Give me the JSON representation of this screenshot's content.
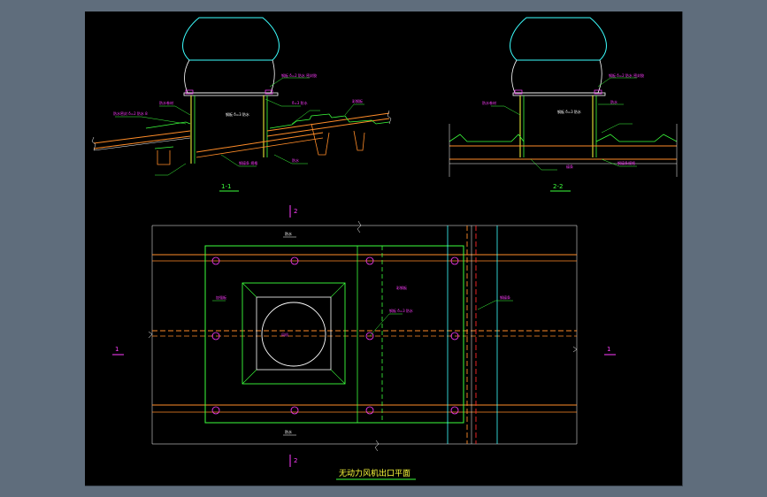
{
  "colors": {
    "background": "#000000",
    "frame": "#5f6d7c",
    "white": "#ffffff",
    "green": "#3cff3c",
    "cyan": "#3cffff",
    "magenta": "#ff3cff",
    "yellow": "#ffff3c",
    "orange": "#ff8c28",
    "red": "#ff2a2a"
  },
  "drawing": {
    "title": "无动力风机出口平面",
    "section_1": {
      "label": "1-1",
      "callouts": {
        "top": "钢板 δ=2 防水 密封胶",
        "mid": "钢板 δ=3 防水",
        "left1": "防水密封 δ=2 防水 8",
        "left2": "防水卷材",
        "right1": "彩钢板",
        "right2": "δ=3 防水",
        "bottom1": "钢檩条 规格",
        "bottom2": "防水"
      }
    },
    "section_2": {
      "label": "2-2",
      "callouts": {
        "top": "钢板 δ=2 防水 密封胶",
        "mid": "钢板 δ=3 防水",
        "left": "防水卷材",
        "right": "防水",
        "bottom1": "檩条",
        "bottom2": "钢檩条规格"
      }
    },
    "plan": {
      "center_label": "风机",
      "marker_left": "1",
      "marker_right": "1",
      "marker_top": "2",
      "marker_bottom": "2",
      "callouts": {
        "a": "彩钢板",
        "b": "加强板",
        "c": "钢板 δ=3 防水",
        "d": "钢檩条",
        "e": "防水",
        "f": "防水"
      }
    }
  }
}
